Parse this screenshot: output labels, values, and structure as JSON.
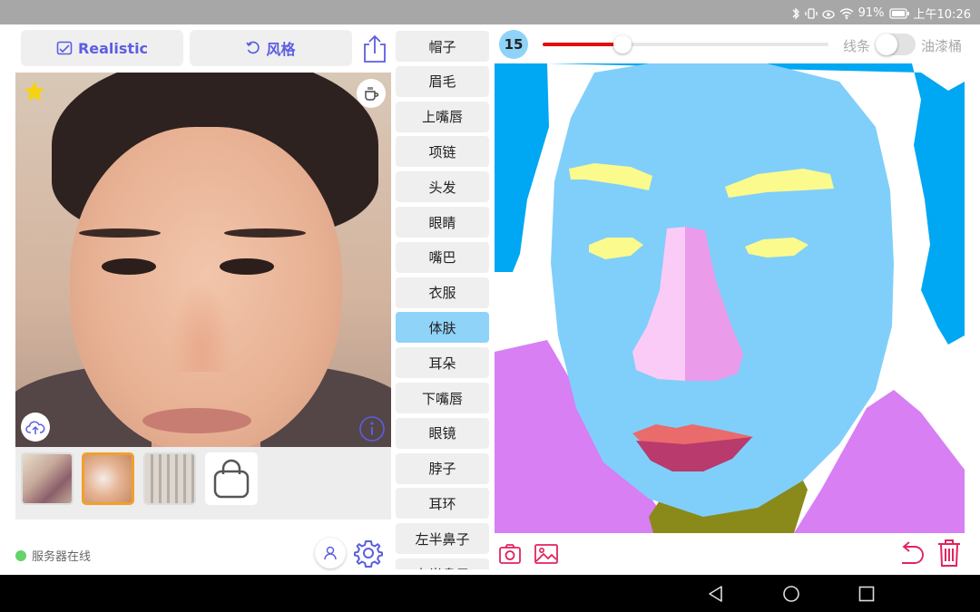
{
  "status_bar": {
    "battery_percent": "91%",
    "time": "上午10:26"
  },
  "toolbar": {
    "realistic_label": "Realistic",
    "style_label": "风格"
  },
  "body_parts": [
    "帽子",
    "眉毛",
    "上嘴唇",
    "项链",
    "头发",
    "眼睛",
    "嘴巴",
    "衣服",
    "体肤",
    "耳朵",
    "下嘴唇",
    "眼镜",
    "脖子",
    "耳环",
    "左半鼻子",
    "右半鼻子"
  ],
  "selected_part": "体肤",
  "brush": {
    "size": "15",
    "slider_fraction": 0.28,
    "slider_color": "#e30f0f"
  },
  "mode": {
    "line_label": "线条",
    "bucket_label": "油漆桶"
  },
  "server": {
    "status_text": "服务器在线",
    "status_color": "#63d36a"
  },
  "colors": {
    "accent": "#5c5ee0",
    "selected": "#8fd3f8",
    "hair": "#00a7f2",
    "skin": "#80cffa",
    "eyebrow": "#fbfa8c",
    "eye": "#fbfa8c",
    "nose_left": "#fbcbf7",
    "nose_right": "#ea9bea",
    "upper_lip": "#e96b6b",
    "lower_lip": "#b93a6c",
    "clothes": "#d77ff3",
    "neck": "#8a8a1a",
    "delete": "#e0245e"
  },
  "icons": {
    "realistic": "landscape-icon",
    "style": "refresh-icon",
    "share": "share-icon",
    "favorite": "star-icon",
    "cup": "coffee-cup-icon",
    "upload": "cloud-upload-icon",
    "info": "info-icon",
    "user": "user-icon",
    "settings": "gear-icon",
    "camera": "camera-icon",
    "gallery": "image-icon",
    "undo": "undo-icon",
    "delete": "trash-icon",
    "bag": "shopping-bag-icon"
  }
}
